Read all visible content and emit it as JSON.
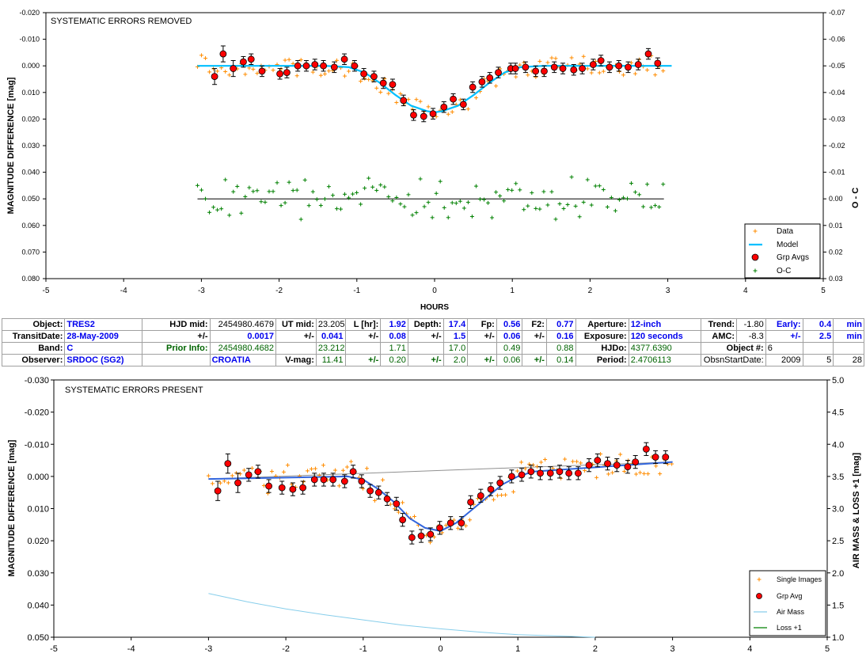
{
  "chart_data": [
    {
      "type": "scatter",
      "title": "SYSTEMATIC ERRORS REMOVED",
      "xlabel": "HOURS",
      "ylabel": "MAGNITUDE DIFFERENCE [mag]",
      "ylabel2": "O - C",
      "xlim": [
        -5,
        5
      ],
      "ylim": [
        -0.02,
        0.08
      ],
      "y2lim": [
        -0.07,
        0.03
      ],
      "yticks": [
        "-0.020",
        "-0.010",
        "0.000",
        "0.010",
        "0.020",
        "0.030",
        "0.040",
        "0.050",
        "0.060",
        "0.070",
        "0.080"
      ],
      "y2ticks": [
        "-0.07",
        "-0.06",
        "-0.05",
        "-0.04",
        "-0.03",
        "-0.02",
        "-0.01",
        "0.00",
        "0.01",
        "0.02",
        "0.03"
      ],
      "xticks": [
        "-5",
        "-4",
        "-3",
        "-2",
        "-1",
        "0",
        "1",
        "2",
        "3",
        "4",
        "5"
      ],
      "legend": [
        "Data",
        "Model",
        "Grp Avgs",
        "O-C"
      ],
      "legend_position": "bottom-right",
      "colors": {
        "data": "#ff8c00",
        "model": "#00bfff",
        "grp": "#ff0000",
        "oc": "#008000",
        "ocline": "#000000"
      },
      "grp_avgs": {
        "x": [
          -2.83,
          -2.72,
          -2.59,
          -2.46,
          -2.36,
          -2.22,
          -1.99,
          -1.9,
          -1.76,
          -1.65,
          -1.54,
          -1.43,
          -1.29,
          -1.16,
          -1.03,
          -0.91,
          -0.78,
          -0.66,
          -0.54,
          -0.4,
          -0.27,
          -0.14,
          -0.02,
          0.12,
          0.24,
          0.37,
          0.49,
          0.61,
          0.71,
          0.82,
          0.98,
          1.04,
          1.17,
          1.3,
          1.41,
          1.54,
          1.65,
          1.79,
          1.9,
          2.04,
          2.14,
          2.25,
          2.37,
          2.49,
          2.62,
          2.75,
          2.87
        ],
        "y": [
          0.004,
          -0.0045,
          0.001,
          -0.0015,
          -0.0025,
          0.002,
          0.003,
          0.0025,
          0.0,
          0.0,
          -0.0005,
          0.0,
          0.0005,
          -0.0025,
          0.0,
          0.003,
          0.004,
          0.0065,
          0.007,
          0.013,
          0.0185,
          0.019,
          0.018,
          0.0155,
          0.0125,
          0.0145,
          0.008,
          0.006,
          0.0045,
          0.0025,
          0.001,
          0.001,
          0.0005,
          0.002,
          0.002,
          0.0005,
          0.001,
          0.0015,
          0.001,
          -0.0005,
          -0.002,
          0.0005,
          0.0,
          0.0005,
          -0.0005,
          -0.0045,
          -0.001
        ],
        "err": [
          0.003,
          0.003,
          0.003,
          0.002,
          0.002,
          0.002,
          0.002,
          0.002,
          0.002,
          0.002,
          0.002,
          0.002,
          0.002,
          0.002,
          0.002,
          0.002,
          0.002,
          0.002,
          0.002,
          0.002,
          0.002,
          0.002,
          0.002,
          0.002,
          0.002,
          0.002,
          0.002,
          0.002,
          0.002,
          0.002,
          0.002,
          0.002,
          0.002,
          0.002,
          0.002,
          0.002,
          0.002,
          0.002,
          0.002,
          0.002,
          0.002,
          0.002,
          0.002,
          0.002,
          0.002,
          0.002,
          0.002
        ]
      },
      "model": {
        "x": [
          -3.05,
          -1.4,
          -1.1,
          -0.9,
          -0.7,
          -0.5,
          -0.3,
          -0.1,
          0.0,
          0.1,
          0.3,
          0.5,
          0.7,
          0.9,
          1.1,
          1.4,
          3.05
        ],
        "y": [
          0.0,
          0.0,
          0.0005,
          0.0025,
          0.0065,
          0.011,
          0.015,
          0.017,
          0.0175,
          0.017,
          0.015,
          0.011,
          0.0065,
          0.0025,
          0.0005,
          0.0,
          0.0
        ]
      },
      "oc_line": {
        "x": [
          -3.05,
          2.95
        ],
        "y": [
          0.0,
          0.0
        ]
      }
    },
    {
      "type": "scatter",
      "title": "SYSTEMATIC ERRORS PRESENT",
      "xlabel": "",
      "ylabel": "MAGNITUDE DIFFERENCE [mag]",
      "ylabel2": "AIR MASS & LOSS +1 [mag]",
      "xlim": [
        -5,
        5
      ],
      "ylim": [
        -0.03,
        0.05
      ],
      "y2lim": [
        5.0,
        1.0
      ],
      "yticks": [
        "-0.030",
        "-0.020",
        "-0.010",
        "0.000",
        "0.010",
        "0.020",
        "0.030",
        "0.040",
        "0.050"
      ],
      "y2ticks": [
        "5.0",
        "4.5",
        "4.0",
        "3.5",
        "3.0",
        "2.5",
        "2.0",
        "1.5",
        "1.0"
      ],
      "xticks": [
        "-5",
        "-4",
        "-3",
        "-2",
        "-1",
        "0",
        "1",
        "2",
        "3",
        "4",
        "5"
      ],
      "legend": [
        "Single Images",
        "Grp Avg",
        "Air Mass",
        "Loss +1"
      ],
      "legend_position": "bottom-right",
      "colors": {
        "single": "#ff8c00",
        "grp": "#ff0000",
        "airmass": "#87ceeb",
        "loss": "#008000",
        "model": "#3366dd",
        "trend": "#909090"
      },
      "grp_avg": {
        "x": [
          -2.88,
          -2.75,
          -2.62,
          -2.48,
          -2.36,
          -2.22,
          -2.05,
          -1.91,
          -1.78,
          -1.63,
          -1.51,
          -1.39,
          -1.24,
          -1.13,
          -1.02,
          -0.91,
          -0.8,
          -0.69,
          -0.57,
          -0.49,
          -0.37,
          -0.25,
          -0.13,
          -0.01,
          0.13,
          0.27,
          0.39,
          0.52,
          0.65,
          0.77,
          0.92,
          1.05,
          1.17,
          1.29,
          1.42,
          1.54,
          1.66,
          1.78,
          1.92,
          2.03,
          2.16,
          2.28,
          2.42,
          2.52,
          2.66,
          2.78,
          2.91
        ],
        "y": [
          0.0045,
          -0.004,
          0.002,
          -0.0005,
          -0.0015,
          0.003,
          0.0035,
          0.004,
          0.0035,
          0.001,
          0.001,
          0.001,
          0.0015,
          -0.0015,
          0.0015,
          0.0045,
          0.005,
          0.007,
          0.0085,
          0.0135,
          0.019,
          0.0185,
          0.018,
          0.016,
          0.0145,
          0.0145,
          0.008,
          0.006,
          0.004,
          0.002,
          0.0,
          -0.0005,
          -0.0015,
          -0.001,
          -0.001,
          -0.0015,
          -0.001,
          -0.001,
          -0.0035,
          -0.005,
          -0.004,
          -0.0035,
          -0.003,
          -0.0045,
          -0.0085,
          -0.006,
          -0.006
        ],
        "err": [
          0.003,
          0.003,
          0.003,
          0.002,
          0.002,
          0.002,
          0.002,
          0.002,
          0.002,
          0.002,
          0.002,
          0.002,
          0.002,
          0.002,
          0.002,
          0.002,
          0.002,
          0.002,
          0.002,
          0.002,
          0.002,
          0.002,
          0.002,
          0.002,
          0.002,
          0.002,
          0.002,
          0.002,
          0.002,
          0.002,
          0.002,
          0.002,
          0.002,
          0.002,
          0.002,
          0.002,
          0.002,
          0.002,
          0.002,
          0.002,
          0.002,
          0.002,
          0.002,
          0.002,
          0.002,
          0.002,
          0.002
        ]
      },
      "model": {
        "x": [
          -3.0,
          -1.2,
          -1.0,
          -0.8,
          -0.6,
          -0.4,
          -0.2,
          0.0,
          0.2,
          0.4,
          0.6,
          0.8,
          1.0,
          1.2,
          3.0
        ],
        "y": [
          0.0008,
          0.0,
          0.001,
          0.004,
          0.008,
          0.013,
          0.016,
          0.017,
          0.0145,
          0.0105,
          0.0065,
          0.0025,
          0.0,
          -0.0015,
          -0.0045
        ]
      },
      "trend": {
        "x": [
          -3.0,
          3.0
        ],
        "y": [
          0.0008,
          -0.0045
        ]
      },
      "airmass": {
        "x": [
          -3.0,
          -2.5,
          -2.0,
          -1.5,
          -1.0,
          -0.5,
          0.0,
          0.5,
          1.0,
          1.5,
          2.0
        ],
        "y2": [
          1.68,
          1.55,
          1.44,
          1.35,
          1.27,
          1.19,
          1.13,
          1.08,
          1.04,
          1.02,
          1.0
        ]
      }
    }
  ],
  "info": {
    "r1": {
      "object_lbl": "Object:",
      "object": "TRES2",
      "hjdmid_lbl": "HJD mid:",
      "hjdmid": "2454980.4679",
      "utmid_lbl": "UT mid:",
      "utmid": "23.205",
      "l_lbl": "L [hr]:",
      "l": "1.92",
      "depth_lbl": "Depth:",
      "depth": "17.4",
      "fp_lbl": "Fp:",
      "fp": "0.56",
      "f2_lbl": "F2:",
      "f2": "0.77",
      "aperture_lbl": "Aperture:",
      "aperture": "12-inch",
      "trend_lbl": "Trend:",
      "trend": "-1.80",
      "early_lbl": "Early:",
      "early": "0.4",
      "early_unit": "min"
    },
    "r2": {
      "transit_lbl": "TransitDate:",
      "transit": "28-May-2009",
      "pm1": "+/-",
      "hjd_err": "0.0017",
      "pm2": "+/-",
      "ut_err": "0.041",
      "pm3": "+/-",
      "l_err": "0.08",
      "pm4": "+/-",
      "depth_err": "1.5",
      "pm5": "+/-",
      "fp_err": "0.06",
      "pm6": "+/-",
      "f2_err": "0.16",
      "exposure_lbl": "Exposure:",
      "exposure": "120 seconds",
      "amc_lbl": "AMC:",
      "amc": "-8.3",
      "pm7": "+/-",
      "early_err": "2.5",
      "early_err_unit": "min"
    },
    "r3": {
      "band_lbl": "Band:",
      "band": "C",
      "prior_lbl": "Prior Info:",
      "prior_hjd": "2454980.4682",
      "prior_ut": "23.212",
      "prior_l": "1.71",
      "prior_depth": "17.0",
      "prior_fp": "0.49",
      "prior_f2": "0.88",
      "hjdo_lbl": "HJDo:",
      "hjdo": "4377.6390",
      "objnum_lbl": "Object #:",
      "objnum": "6"
    },
    "r4": {
      "observer_lbl": "Observer:",
      "observer": "SRDOC (SG2)",
      "country": "CROATIA",
      "vmag_lbl": "V-mag:",
      "vmag": "11.41",
      "pm1": "+/-",
      "vmag_err": "0.20",
      "pm2": "+/-",
      "v2_err": "2.0",
      "pm3": "+/-",
      "v3_err": "0.06",
      "pm4": "+/-",
      "v4_err": "0.14",
      "period_lbl": "Period:",
      "period": "2.4706113",
      "obsn_lbl": "ObsnStartDate:",
      "yr": "2009",
      "mo": "5",
      "dy": "28"
    }
  }
}
